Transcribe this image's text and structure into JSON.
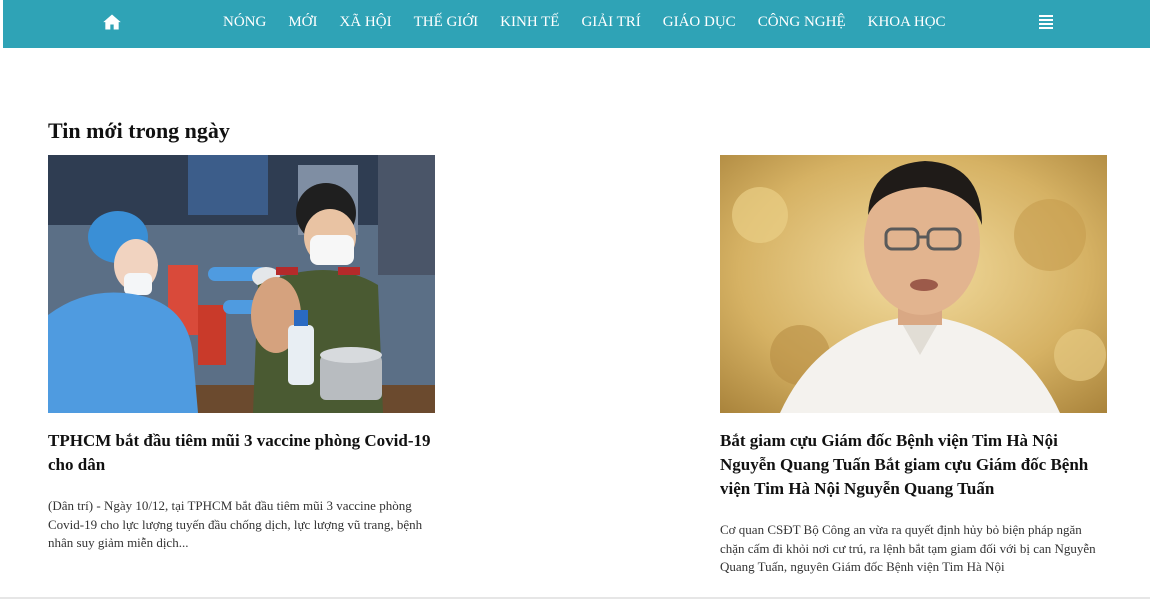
{
  "nav": {
    "home_icon": "home-icon",
    "menu_icon": "menu-icon",
    "brand_color": "#2fa3b6",
    "items": [
      {
        "label": "NÓNG"
      },
      {
        "label": "MỚI"
      },
      {
        "label": "XÃ HỘI"
      },
      {
        "label": "THẾ GIỚI"
      },
      {
        "label": "KINH TẾ"
      },
      {
        "label": "GIẢI TRÍ"
      },
      {
        "label": "GIÁO DỤC"
      },
      {
        "label": "CÔNG NGHỆ"
      },
      {
        "label": "KHOA HỌC"
      }
    ]
  },
  "main": {
    "section_title": "Tin mới trong ngày",
    "articles": [
      {
        "title": "TPHCM bắt đầu tiêm mũi 3 vaccine phòng Covid-19 cho dân",
        "description": "(Dân trí) - Ngày 10/12, tại TPHCM bắt đầu tiêm mũi 3 vaccine phòng Covid-19 cho lực lượng tuyến đầu chống dịch, lực lượng vũ trang, bệnh nhân suy giảm miễn dịch..."
      },
      {
        "title": "Bắt giam cựu Giám đốc Bệnh viện Tim Hà Nội Nguyễn Quang Tuấn Bắt giam cựu Giám đốc Bệnh viện Tim Hà Nội Nguyễn Quang Tuấn",
        "description": "Cơ quan CSĐT Bộ Công an vừa ra quyết định hủy bỏ biện pháp ngăn chặn cấm đi khỏi nơi cư trú, ra lệnh bắt tạm giam đối với bị can Nguyễn Quang Tuấn, nguyên Giám đốc Bệnh viện Tim Hà Nội"
      }
    ]
  }
}
